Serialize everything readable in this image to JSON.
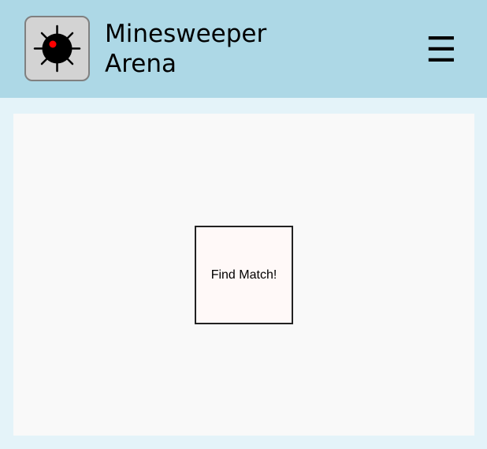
{
  "header": {
    "logo_icon": "mine-icon",
    "title_line1": "Minesweeper",
    "title_line2": "Arena",
    "menu_glyph": "☰",
    "menu_icon": "hamburger-menu-icon",
    "background": "#add8e6"
  },
  "main": {
    "find_match_label": "Find Match!"
  },
  "colors": {
    "page_bg": "#e4f3f9",
    "panel_bg": "#f9f9f9",
    "mine_highlight": "#ff0000"
  }
}
